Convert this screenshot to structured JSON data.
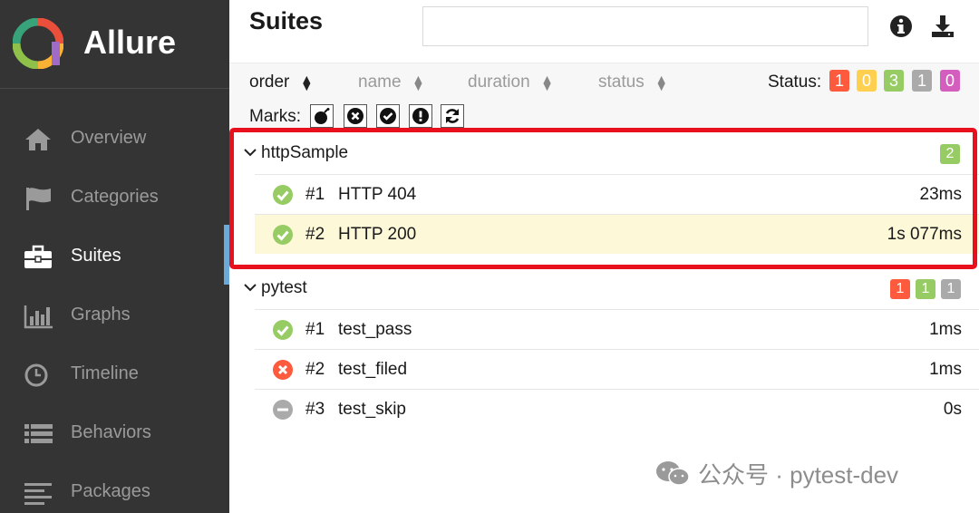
{
  "app": {
    "name": "Allure"
  },
  "sidebar": {
    "items": [
      {
        "label": "Overview",
        "icon": "home-icon"
      },
      {
        "label": "Categories",
        "icon": "flag-icon"
      },
      {
        "label": "Suites",
        "icon": "briefcase-icon",
        "active": true
      },
      {
        "label": "Graphs",
        "icon": "bar-chart-icon"
      },
      {
        "label": "Timeline",
        "icon": "clock-icon"
      },
      {
        "label": "Behaviors",
        "icon": "list-icon"
      },
      {
        "label": "Packages",
        "icon": "align-left-icon"
      }
    ]
  },
  "header": {
    "title": "Suites",
    "search_value": ""
  },
  "toolbar": {
    "sorters": [
      "order",
      "name",
      "duration",
      "status"
    ],
    "status_label": "Status:",
    "status_counts": [
      {
        "value": "1",
        "color": "#fd5a3e"
      },
      {
        "value": "0",
        "color": "#ffd050"
      },
      {
        "value": "3",
        "color": "#97cc64"
      },
      {
        "value": "1",
        "color": "#aaaaaa"
      },
      {
        "value": "0",
        "color": "#d35ebe"
      }
    ],
    "marks_label": "Marks:"
  },
  "groups": [
    {
      "name": "httpSample",
      "counts": [
        {
          "value": "2",
          "color": "#97cc64"
        }
      ],
      "tests": [
        {
          "num": "#1",
          "name": "HTTP 404",
          "duration": "23ms",
          "status": "passed"
        },
        {
          "num": "#2",
          "name": "HTTP 200",
          "duration": "1s 077ms",
          "status": "passed"
        }
      ]
    },
    {
      "name": "pytest",
      "counts": [
        {
          "value": "1",
          "color": "#fd5a3e"
        },
        {
          "value": "1",
          "color": "#97cc64"
        },
        {
          "value": "1",
          "color": "#aaaaaa"
        }
      ],
      "tests": [
        {
          "num": "#1",
          "name": "test_pass",
          "duration": "1ms",
          "status": "passed"
        },
        {
          "num": "#2",
          "name": "test_filed",
          "duration": "1ms",
          "status": "failed"
        },
        {
          "num": "#3",
          "name": "test_skip",
          "duration": "0s",
          "status": "skipped"
        }
      ]
    }
  ],
  "watermark": {
    "text": "公众号 · pytest-dev"
  },
  "colors": {
    "sidebar_bg": "#343434",
    "highlight_box": "#e8101c",
    "passed": "#97cc64",
    "failed": "#fd5a3e",
    "skipped": "#aaaaaa"
  }
}
